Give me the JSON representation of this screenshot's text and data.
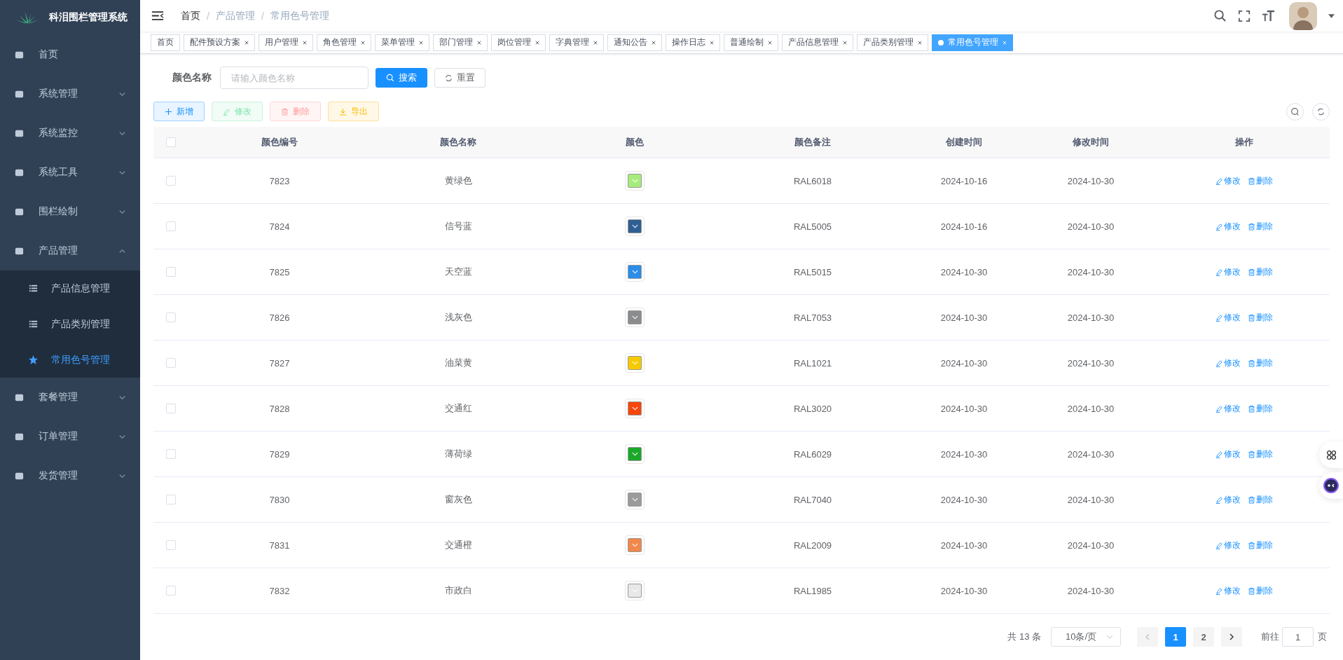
{
  "sidebar": {
    "title": "科泪围栏管理系统",
    "items": [
      {
        "label": "首页"
      },
      {
        "label": "系统管理",
        "expanded": false
      },
      {
        "label": "系统监控",
        "expanded": false
      },
      {
        "label": "系统工具",
        "expanded": false
      },
      {
        "label": "围栏绘制",
        "expanded": false
      },
      {
        "label": "产品管理",
        "expanded": true,
        "children": [
          {
            "label": "产品信息管理",
            "selected": false
          },
          {
            "label": "产品类别管理",
            "selected": false
          },
          {
            "label": "常用色号管理",
            "selected": true
          }
        ]
      },
      {
        "label": "套餐管理",
        "expanded": false
      },
      {
        "label": "订单管理",
        "expanded": false
      },
      {
        "label": "发货管理",
        "expanded": false
      }
    ]
  },
  "breadcrumb": [
    {
      "label": "首页"
    },
    {
      "separator": "/",
      "label": "产品管理"
    },
    {
      "separator": "/",
      "label": "常用色号管理"
    }
  ],
  "tabs": [
    {
      "label": "首页",
      "selected": false,
      "closable": false
    },
    {
      "label": "配件预设方案",
      "selected": false,
      "closable": true
    },
    {
      "label": "用户管理",
      "selected": false,
      "closable": true
    },
    {
      "label": "角色管理",
      "selected": false,
      "closable": true
    },
    {
      "label": "菜单管理",
      "selected": false,
      "closable": true
    },
    {
      "label": "部门管理",
      "selected": false,
      "closable": true
    },
    {
      "label": "岗位管理",
      "selected": false,
      "closable": true
    },
    {
      "label": "字典管理",
      "selected": false,
      "closable": true
    },
    {
      "label": "通知公告",
      "selected": false,
      "closable": true
    },
    {
      "label": "操作日志",
      "selected": false,
      "closable": true
    },
    {
      "label": "普通绘制",
      "selected": false,
      "closable": true
    },
    {
      "label": "产品信息管理",
      "selected": false,
      "closable": true
    },
    {
      "label": "产品类别管理",
      "selected": false,
      "closable": true
    },
    {
      "label": "常用色号管理",
      "selected": true,
      "closable": true
    }
  ],
  "search": {
    "label": "颜色名称",
    "placeholder": "请输入颜色名称",
    "search_button": "搜索",
    "reset_button": "重置"
  },
  "toolbar": [
    {
      "kind": "primary",
      "label": "新增",
      "disabled": false
    },
    {
      "kind": "success",
      "label": "修改",
      "disabled": true
    },
    {
      "kind": "danger",
      "label": "删除",
      "disabled": true
    },
    {
      "kind": "warning",
      "label": "导出",
      "disabled": false
    }
  ],
  "table": {
    "header_checked": false,
    "columns": [
      "颜色编号",
      "颜色名称",
      "颜色",
      "颜色备注",
      "创建时间",
      "修改时间",
      "操作"
    ],
    "rows": [
      {
        "checked": false,
        "id": "7823",
        "name": "黄绿色",
        "color": "#a6ec7c",
        "remark": "RAL6018",
        "created": "2024-10-16",
        "modified": "2024-10-30",
        "edit": "修改",
        "delete": "删除"
      },
      {
        "checked": false,
        "id": "7824",
        "name": "信号蓝",
        "color": "#2f5f93",
        "remark": "RAL5005",
        "created": "2024-10-16",
        "modified": "2024-10-30",
        "edit": "修改",
        "delete": "删除"
      },
      {
        "checked": false,
        "id": "7825",
        "name": "天空蓝",
        "color": "#2a8de8",
        "remark": "RAL5015",
        "created": "2024-10-30",
        "modified": "2024-10-30",
        "edit": "修改",
        "delete": "删除"
      },
      {
        "checked": false,
        "id": "7826",
        "name": "浅灰色",
        "color": "#8a8c8e",
        "remark": "RAL7053",
        "created": "2024-10-30",
        "modified": "2024-10-30",
        "edit": "修改",
        "delete": "删除"
      },
      {
        "checked": false,
        "id": "7827",
        "name": "油菜黄",
        "color": "#f7ca00",
        "remark": "RAL1021",
        "created": "2024-10-30",
        "modified": "2024-10-30",
        "edit": "修改",
        "delete": "删除"
      },
      {
        "checked": false,
        "id": "7828",
        "name": "交通红",
        "color": "#f7460c",
        "remark": "RAL3020",
        "created": "2024-10-30",
        "modified": "2024-10-30",
        "edit": "修改",
        "delete": "删除"
      },
      {
        "checked": false,
        "id": "7829",
        "name": "薄荷绿",
        "color": "#1aa829",
        "remark": "RAL6029",
        "created": "2024-10-30",
        "modified": "2024-10-30",
        "edit": "修改",
        "delete": "删除"
      },
      {
        "checked": false,
        "id": "7830",
        "name": "窗灰色",
        "color": "#9b9b9b",
        "remark": "RAL7040",
        "created": "2024-10-30",
        "modified": "2024-10-30",
        "edit": "修改",
        "delete": "删除"
      },
      {
        "checked": false,
        "id": "7831",
        "name": "交通橙",
        "color": "#f2874b",
        "remark": "RAL2009",
        "created": "2024-10-30",
        "modified": "2024-10-30",
        "edit": "修改",
        "delete": "删除"
      },
      {
        "checked": false,
        "id": "7832",
        "name": "市政白",
        "color": "#e8e8e8",
        "remark": "RAL1985",
        "created": "2024-10-30",
        "modified": "2024-10-30",
        "edit": "修改",
        "delete": "删除"
      }
    ]
  },
  "pagination": {
    "total": "共 13 条",
    "page_size": "10条/页",
    "pages": [
      {
        "label": "1",
        "selected": true
      },
      {
        "label": "2",
        "selected": false
      }
    ],
    "goto_label": "前往",
    "goto_value": "1",
    "goto_unit": "页"
  }
}
